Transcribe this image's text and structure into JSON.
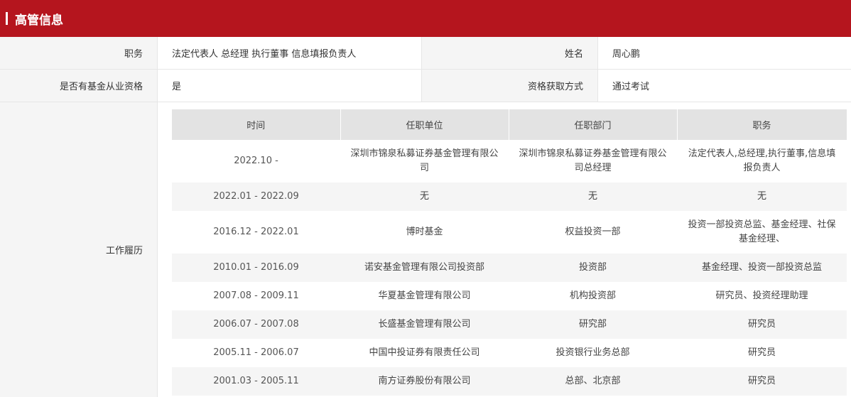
{
  "header": {
    "title": "高管信息"
  },
  "info": {
    "position_label": "职务",
    "position_value": "法定代表人 总经理 执行董事 信息填报负责人",
    "name_label": "姓名",
    "name_value": "周心鹏",
    "qual_label": "是否有基金从业资格",
    "qual_value": "是",
    "method_label": "资格获取方式",
    "method_value": "通过考试"
  },
  "history": {
    "label": "工作履历",
    "columns": [
      "时间",
      "任职单位",
      "任职部门",
      "职务"
    ],
    "rows": [
      {
        "time": "2022.10 -",
        "company": "深圳市锦泉私募证券基金管理有限公司",
        "dept": "深圳市锦泉私募证券基金管理有限公司总经理",
        "role": "法定代表人,总经理,执行董事,信息填报负责人"
      },
      {
        "time": "2022.01 - 2022.09",
        "company": "无",
        "dept": "无",
        "role": "无"
      },
      {
        "time": "2016.12 - 2022.01",
        "company": "博时基金",
        "dept": "权益投资一部",
        "role": "投资一部投资总监、基金经理、社保基金经理、"
      },
      {
        "time": "2010.01 - 2016.09",
        "company": "诺安基金管理有限公司投资部",
        "dept": "投资部",
        "role": "基金经理、投资一部投资总监"
      },
      {
        "time": "2007.08 - 2009.11",
        "company": "华夏基金管理有限公司",
        "dept": "机构投资部",
        "role": "研究员、投资经理助理"
      },
      {
        "time": "2006.07 - 2007.08",
        "company": "长盛基金管理有限公司",
        "dept": "研究部",
        "role": "研究员"
      },
      {
        "time": "2005.11 - 2006.07",
        "company": "中国中投证券有限责任公司",
        "dept": "投资银行业务总部",
        "role": "研究员"
      },
      {
        "time": "2001.03 - 2005.11",
        "company": "南方证券股份有限公司",
        "dept": "总部、北京部",
        "role": "研究员"
      }
    ]
  }
}
